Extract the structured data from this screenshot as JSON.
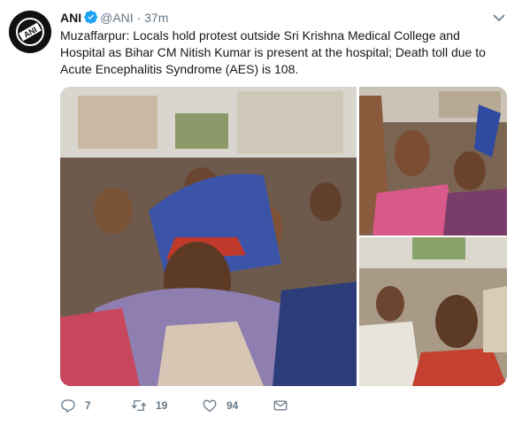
{
  "tweet": {
    "author_name": "ANI",
    "author_handle": "@ANI",
    "separator": "·",
    "time": "37m",
    "avatar_text": "ANI",
    "text": "Muzaffarpur: Locals hold protest outside Sri Krishna Medical College and Hospital as Bihar CM Nitish Kumar is present at the hospital; Death toll due to Acute Encephalitis Syndrome (AES) is 108.",
    "replies": "7",
    "retweets": "19",
    "likes": "94"
  },
  "icons": {
    "verified": "verified-badge-icon",
    "menu": "chevron-down-icon",
    "reply": "reply-icon",
    "retweet": "retweet-icon",
    "like": "heart-icon",
    "dm": "envelope-icon"
  },
  "colors": {
    "verified": "#1da1f2",
    "meta": "#657786",
    "text": "#14171a"
  }
}
